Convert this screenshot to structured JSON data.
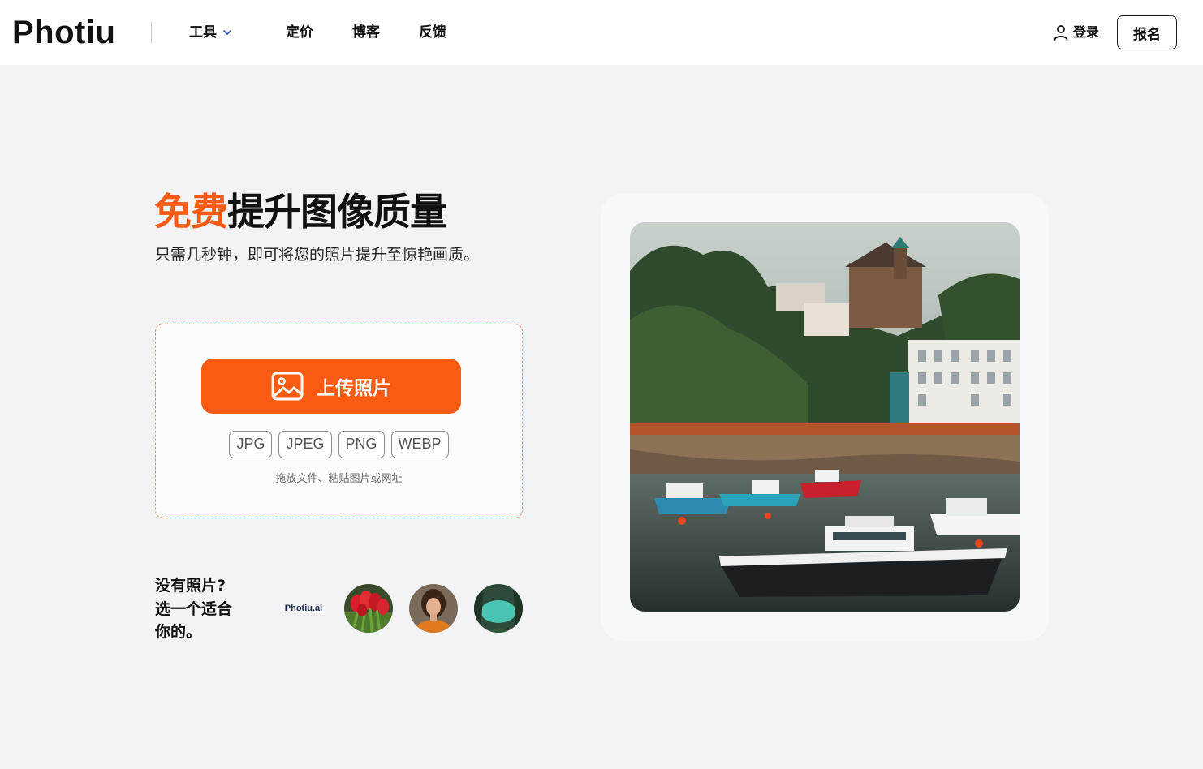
{
  "header": {
    "logo": "Photiu",
    "nav": [
      {
        "label": "工具",
        "has_dropdown": true
      },
      {
        "label": "定价"
      },
      {
        "label": "博客"
      },
      {
        "label": "反馈"
      }
    ],
    "login_label": "登录",
    "signup_label": "报名"
  },
  "hero": {
    "title_accent": "免费",
    "title_rest": "提升图像质量",
    "subtitle": "只需几秒钟，即可将您的照片提升至惊艳画质。"
  },
  "upload": {
    "button_label": "上传照片",
    "formats": [
      "JPG",
      "JPEG",
      "PNG",
      "WEBP"
    ],
    "hint": "拖放文件、粘贴图片或网址"
  },
  "samples": {
    "prompt_lines": [
      "没有照片?",
      "选一个适合",
      "你的。"
    ],
    "brand_label": "Photiu.ai",
    "thumbs": [
      "tulips-photo",
      "portrait-photo",
      "lake-photo"
    ]
  },
  "preview": {
    "subject": "harbor-boats-photo"
  },
  "colors": {
    "accent": "#fa5b14",
    "background": "#f3f2f4"
  }
}
